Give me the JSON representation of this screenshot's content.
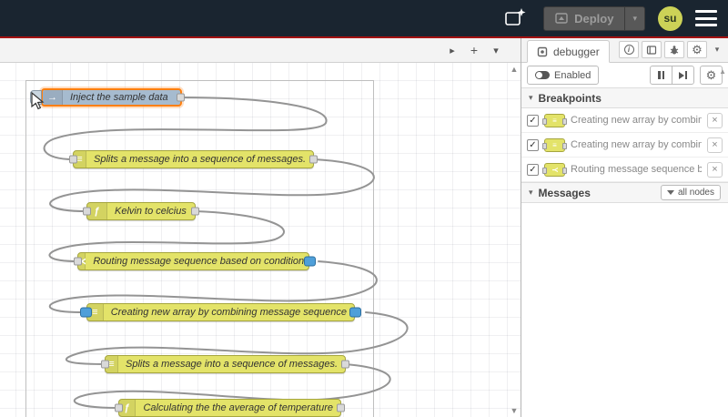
{
  "header": {
    "deploy": {
      "label": "Deploy",
      "arrow_glyph": "▾"
    },
    "avatar": {
      "initials": "su"
    }
  },
  "workspace": {
    "toolbar": {
      "next_glyph": "▸",
      "add_glyph": "+",
      "list_glyph": "▾"
    },
    "scroll": {
      "up_glyph": "▲",
      "down_glyph": "▼"
    },
    "nodes": [
      {
        "label": "Inject the sample data",
        "glyph": "→"
      },
      {
        "label": "Splits a message into a sequence of messages.",
        "glyph": "≡"
      },
      {
        "label": "Kelvin to celcius",
        "glyph": "ƒ"
      },
      {
        "label": "Routing message sequence based on condition",
        "glyph": "Y"
      },
      {
        "label": "Creating new array by combining message sequence",
        "glyph": "≡"
      },
      {
        "label": "Splits a message into a sequence of messages.",
        "glyph": "≡"
      },
      {
        "label": "Calculating the the average of temperature",
        "glyph": "ƒ"
      }
    ]
  },
  "sidebar": {
    "tab": {
      "label": "debugger"
    },
    "toolbar": {
      "enabled_label": "Enabled",
      "gear_glyph": "⚙",
      "scroll_up_glyph": "▲"
    },
    "tab_actions": {
      "info_glyph": "i",
      "gear_glyph": "⚙",
      "chevron_glyph": "▾"
    },
    "breakpoints": {
      "title": "Breakpoints",
      "chevron_glyph": "▾",
      "close_glyph": "×",
      "items": [
        {
          "label": "Creating new array by combini",
          "checked_glyph": "✓",
          "glyph": "≡"
        },
        {
          "label": "Creating new array by combini",
          "checked_glyph": "✓",
          "glyph": "≡"
        },
        {
          "label": "Routing message sequence ba",
          "checked_glyph": "✓",
          "glyph": "Y"
        }
      ]
    },
    "messages": {
      "title": "Messages",
      "chevron_glyph": "▾",
      "filter_label": "all nodes"
    }
  }
}
